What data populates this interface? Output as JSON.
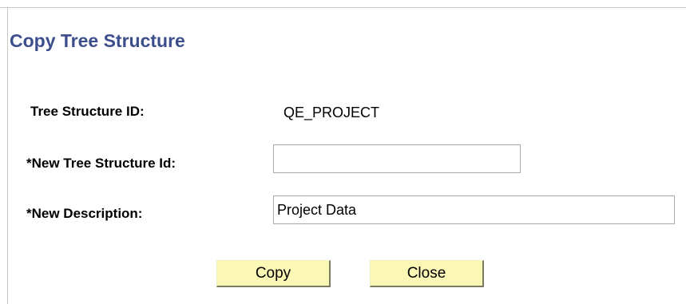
{
  "page": {
    "title": "Copy Tree Structure"
  },
  "form": {
    "tree_structure_id_label": "Tree Structure ID:",
    "tree_structure_id_value": "QE_PROJECT",
    "new_tree_structure_id_label": "*New Tree Structure Id:",
    "new_tree_structure_id_value": "",
    "new_description_label": "*New Description:",
    "new_description_value": "Project Data"
  },
  "buttons": {
    "copy_label": "Copy",
    "close_label": "Close"
  },
  "colors": {
    "title": "#3d4e8c",
    "button_face": "#fbf7b5",
    "input_border": "#a9a9a9"
  }
}
